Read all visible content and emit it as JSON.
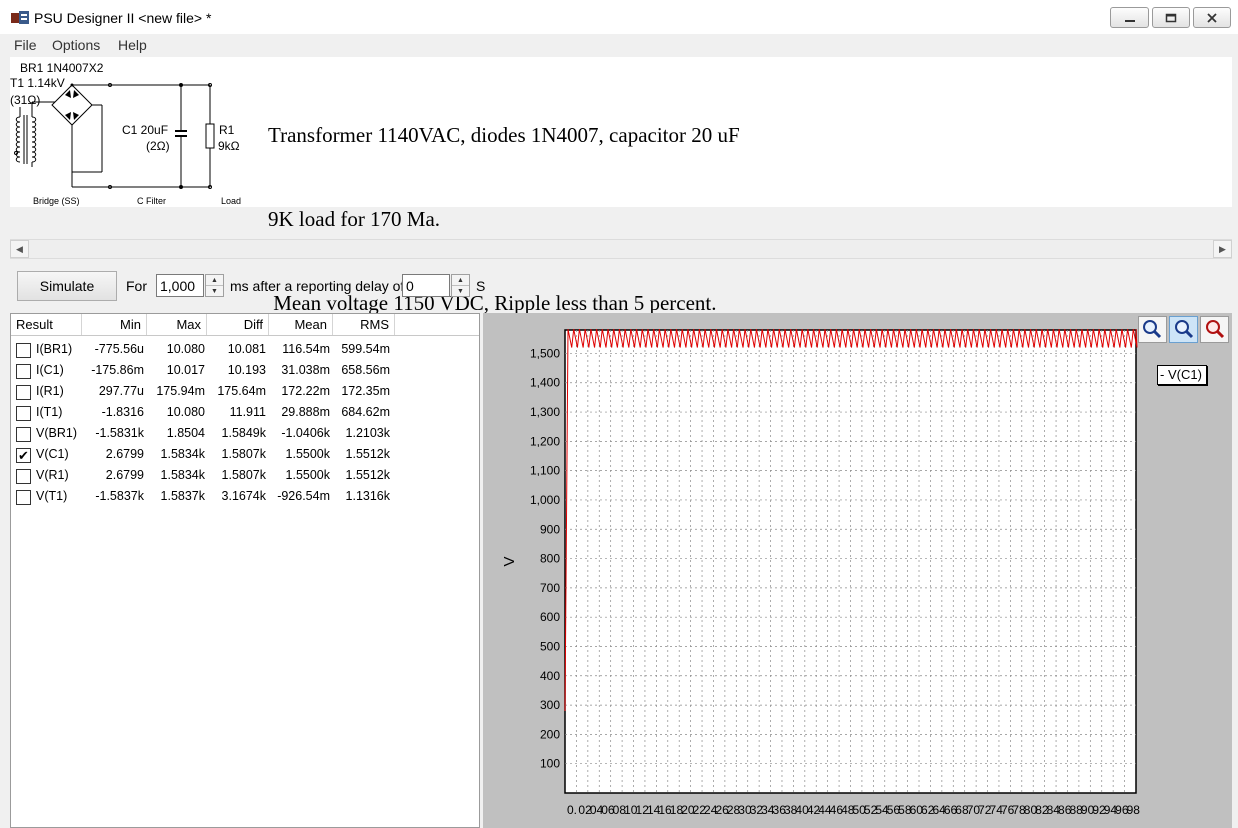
{
  "window": {
    "title": "PSU Designer II  <new file> *"
  },
  "menu": [
    "File",
    "Options",
    "Help"
  ],
  "schematic": {
    "bridge_label": "BR1 1N4007X2",
    "transformer_label": "T1 1.14kV",
    "transformer_res": "(31Ω)",
    "cap_label": "C1 20uF",
    "cap_res": "(2Ω)",
    "load_label": "R1",
    "load_value": "9kΩ",
    "section_bridge": "Bridge (SS)",
    "section_filter": "C Filter",
    "section_load": "Load"
  },
  "notes": [
    "Transformer 1140VAC, diodes 1N4007, capacitor 20 uF",
    "9K load for 170 Ma.",
    " Mean voltage 1150 VDC, Ripple less than 5 percent."
  ],
  "controls": {
    "simulate": "Simulate",
    "for_label": "For",
    "duration": "1,000",
    "ms_label": "ms  after a reporting delay of",
    "delay": "0",
    "s_label": "S"
  },
  "results": {
    "headers": [
      "Result",
      "Min",
      "Max",
      "Diff",
      "Mean",
      "RMS"
    ],
    "rows": [
      {
        "name": "I(BR1)",
        "min": "-775.56u",
        "max": "10.080",
        "diff": "10.081",
        "mean": "116.54m",
        "rms": "599.54m",
        "checked": false
      },
      {
        "name": "I(C1)",
        "min": "-175.86m",
        "max": "10.017",
        "diff": "10.193",
        "mean": "31.038m",
        "rms": "658.56m",
        "checked": false
      },
      {
        "name": "I(R1)",
        "min": "297.77u",
        "max": "175.94m",
        "diff": "175.64m",
        "mean": "172.22m",
        "rms": "172.35m",
        "checked": false
      },
      {
        "name": "I(T1)",
        "min": "-1.8316",
        "max": "10.080",
        "diff": "11.911",
        "mean": "29.888m",
        "rms": "684.62m",
        "checked": false
      },
      {
        "name": "V(BR1)",
        "min": "-1.5831k",
        "max": "1.8504",
        "diff": "1.5849k",
        "mean": "-1.0406k",
        "rms": "1.2103k",
        "checked": false
      },
      {
        "name": "V(C1)",
        "min": "2.6799",
        "max": "1.5834k",
        "diff": "1.5807k",
        "mean": "1.5500k",
        "rms": "1.5512k",
        "checked": true
      },
      {
        "name": "V(R1)",
        "min": "2.6799",
        "max": "1.5834k",
        "diff": "1.5807k",
        "mean": "1.5500k",
        "rms": "1.5512k",
        "checked": false
      },
      {
        "name": "V(T1)",
        "min": "-1.5837k",
        "max": "1.5837k",
        "diff": "3.1674k",
        "mean": "-926.54m",
        "rms": "1.1316k",
        "checked": false
      }
    ]
  },
  "chart_data": {
    "type": "line",
    "ylabel": "V",
    "ylim": [
      0,
      1580
    ],
    "yticks": [
      100,
      200,
      300,
      400,
      500,
      600,
      700,
      800,
      900,
      1000,
      1100,
      1200,
      1300,
      1400,
      1500
    ],
    "ytick_labels": [
      "100",
      "200",
      "300",
      "400",
      "500",
      "600",
      "700",
      "800",
      "900",
      "1,000",
      "1,100",
      "1,200",
      "1,300",
      "1,400",
      "1,500"
    ],
    "xlim": [
      0,
      1
    ],
    "xtick_labels": [
      "0.",
      "02",
      "04",
      "06",
      "08",
      "10",
      "12",
      "14",
      "16",
      "18",
      "20",
      "22",
      "24",
      "26",
      "28",
      "30",
      "32",
      "34",
      "36",
      "38",
      "40",
      "42",
      "44",
      "46",
      "48",
      "50",
      "52",
      "54",
      "56",
      "58",
      "60",
      "62",
      "64",
      "66",
      "68",
      "70",
      "72",
      "74",
      "76",
      "78",
      "80",
      "82",
      "84",
      "86",
      "88",
      "90",
      "92",
      "94",
      "96",
      "98"
    ],
    "series": [
      {
        "name": "V(C1)",
        "color": "#e00000",
        "start": 280,
        "peak": 1583,
        "trough": 1520,
        "cycles": 100
      }
    ],
    "grid": true,
    "legend_position": "right"
  }
}
